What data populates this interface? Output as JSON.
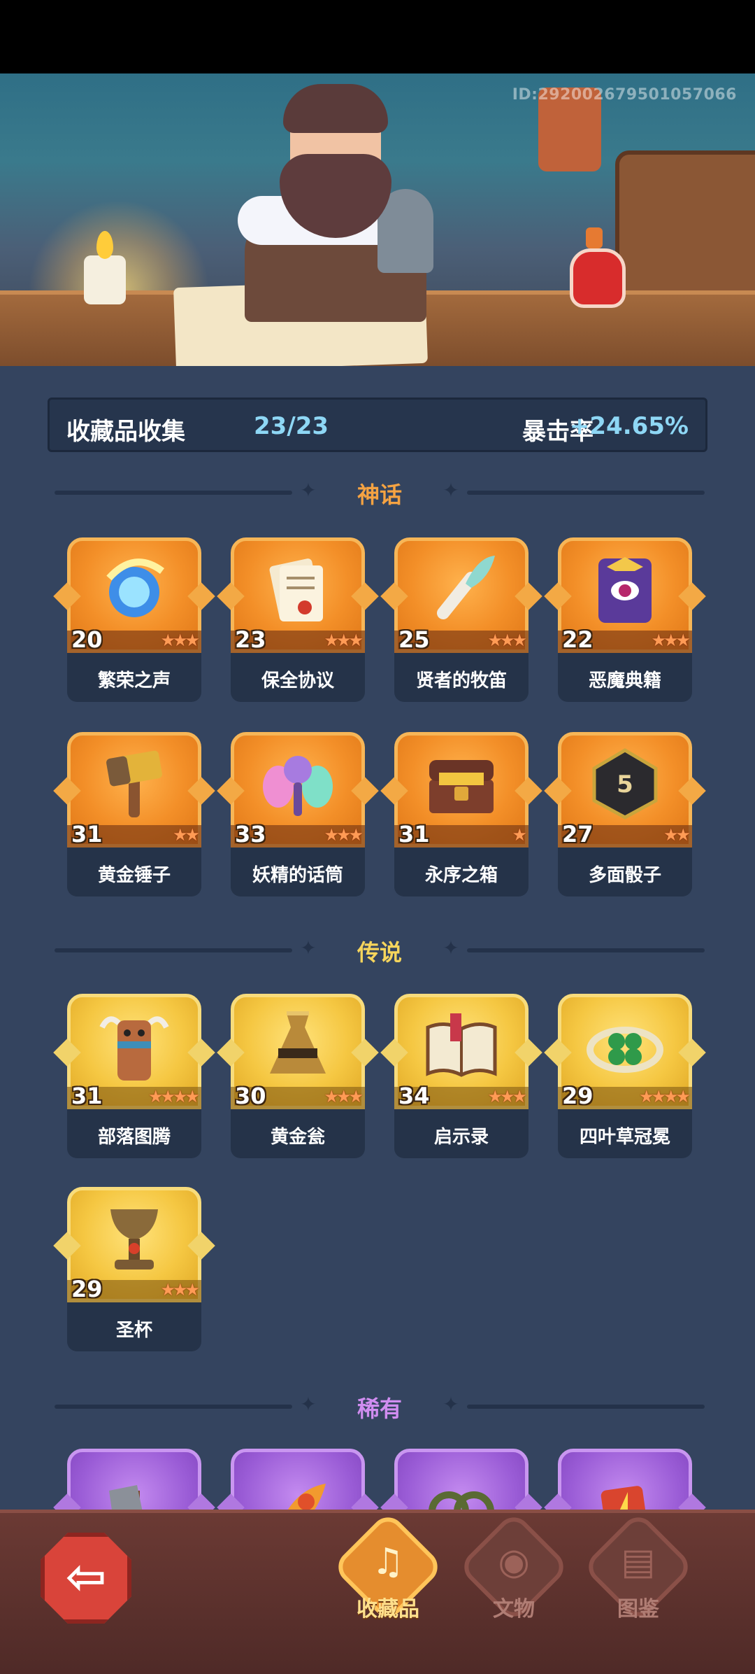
{
  "banner": {
    "player_id": "ID:292002679501057066"
  },
  "summary": {
    "label": "收藏品收集",
    "count": "23/23",
    "bonus_label": "暴击率",
    "bonus_value": "+24.65%"
  },
  "colors": {
    "mythic": "#f39528",
    "legendary": "#f5c742",
    "rare": "#9a5cd6",
    "mythic_title": "#f5a342",
    "legendary_title": "#f6d55c",
    "rare_title": "#d08df0",
    "accent_value": "#8ed7f5"
  },
  "sections": [
    {
      "title": "神话",
      "items": [
        {
          "level": "20",
          "name": "繁荣之声",
          "stars": "★★★",
          "icon": "blue-orb-icon"
        },
        {
          "level": "23",
          "name": "保全协议",
          "stars": "★★★",
          "icon": "scroll-document-icon"
        },
        {
          "level": "25",
          "name": "贤者的牧笛",
          "stars": "★★★",
          "icon": "feather-flute-icon"
        },
        {
          "level": "22",
          "name": "恶魔典籍",
          "stars": "★★★",
          "icon": "demon-book-icon"
        },
        {
          "level": "31",
          "name": "黄金锤子",
          "stars": "★★",
          "icon": "golden-hammer-icon"
        },
        {
          "level": "33",
          "name": "妖精的话筒",
          "stars": "★★★",
          "icon": "fairy-microphone-icon"
        },
        {
          "level": "31",
          "name": "永序之箱",
          "stars": "★",
          "icon": "treasure-chest-icon"
        },
        {
          "level": "27",
          "name": "多面骰子",
          "stars": "★★",
          "icon": "polyhedral-dice-icon"
        }
      ]
    },
    {
      "title": "传说",
      "items": [
        {
          "level": "31",
          "name": "部落图腾",
          "stars": "★★★★",
          "icon": "tribal-totem-icon"
        },
        {
          "level": "30",
          "name": "黄金瓮",
          "stars": "★★★",
          "icon": "golden-urn-icon"
        },
        {
          "level": "34",
          "name": "启示录",
          "stars": "★★★",
          "icon": "open-book-icon"
        },
        {
          "level": "29",
          "name": "四叶草冠冕",
          "stars": "★★★★",
          "icon": "clover-crown-icon"
        },
        {
          "level": "29",
          "name": "圣杯",
          "stars": "★★★",
          "icon": "holy-grail-icon"
        }
      ]
    },
    {
      "title": "稀有",
      "items": [
        {
          "icon": "stone-axe-icon"
        },
        {
          "icon": "phoenix-feather-icon"
        },
        {
          "icon": "thorn-vine-icon"
        },
        {
          "icon": "lightning-card-icon"
        }
      ]
    }
  ],
  "nav": {
    "back_icon": "back-arrow-icon",
    "tabs": [
      {
        "label": "收藏品",
        "icon": "lyre-icon",
        "active": true
      },
      {
        "label": "文物",
        "icon": "eye-relic-icon",
        "active": false
      },
      {
        "label": "图鉴",
        "icon": "codex-book-icon",
        "active": false
      }
    ]
  }
}
